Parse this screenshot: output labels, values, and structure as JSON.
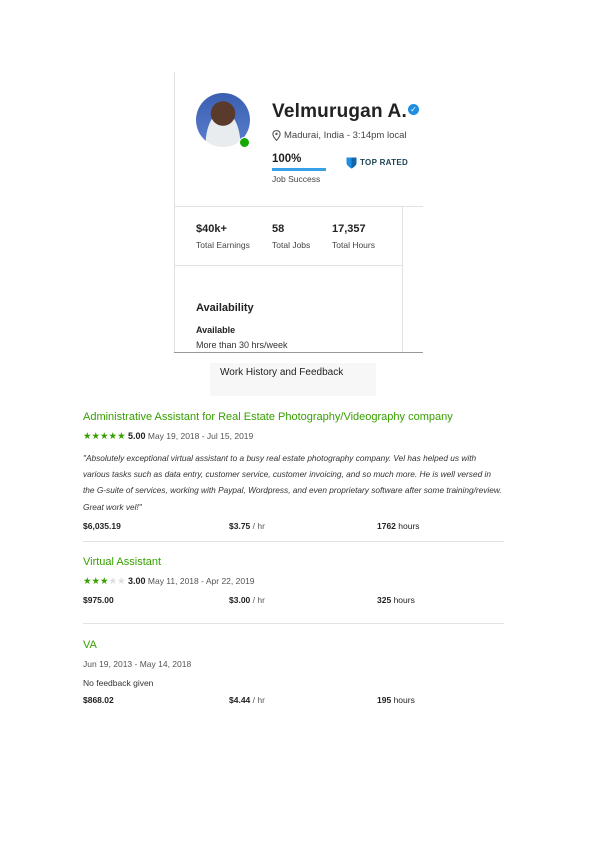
{
  "profile": {
    "name": "Velmurugan A.",
    "location": "Madurai, India - 3:14pm local",
    "job_success_pct": "100%",
    "job_success_value": 1.0,
    "job_success_label": "Job Success",
    "badge": "TOP RATED",
    "stats": [
      {
        "value": "$40k+",
        "label": "Total Earnings"
      },
      {
        "value": "58",
        "label": "Total Jobs"
      },
      {
        "value": "17,357",
        "label": "Total Hours"
      }
    ],
    "availability": {
      "title": "Availability",
      "status": "Available",
      "hours": "More than 30 hrs/week"
    }
  },
  "work_history_tab": "Work History and Feedback",
  "jobs": [
    {
      "title": "Administrative Assistant for Real Estate Photography/Videography company",
      "rating": 5,
      "score": "5.00",
      "dates": "May 19, 2018 - Jul 15, 2019",
      "feedback": "\"Absolutely exceptional virtual assistant to a busy real estate photography company. Vel has helped us with various tasks such as data entry, customer service, customer invoicing, and so much more. He is well versed in the G-suite of services, working with Paypal, Wordpress, and even proprietary software after some training/review. Great work vel!\"",
      "earned": "$6,035.19",
      "rate": "$3.75",
      "rate_unit": "/ hr",
      "hours": "1762",
      "hours_unit": "hours"
    },
    {
      "title": "Virtual Assistant",
      "rating": 3,
      "score": "3.00",
      "dates": "May 11, 2018 - Apr 22, 2019",
      "earned": "$975.00",
      "rate": "$3.00",
      "rate_unit": "/ hr",
      "hours": "325",
      "hours_unit": "hours"
    },
    {
      "title": "VA",
      "dates": "Jun 19, 2013 - May 14, 2018",
      "no_feedback": "No feedback given",
      "earned": "$868.02",
      "rate": "$4.44",
      "rate_unit": "/ hr",
      "hours": "195",
      "hours_unit": "hours"
    }
  ],
  "colors": {
    "accent_green": "#37a000",
    "online": "#14a800",
    "jss_bar": "#37a0e6",
    "verified": "#1f8de0"
  },
  "icons": [
    "location-pin-icon",
    "verified-check-icon",
    "top-rated-shield-icon",
    "star-icon"
  ]
}
